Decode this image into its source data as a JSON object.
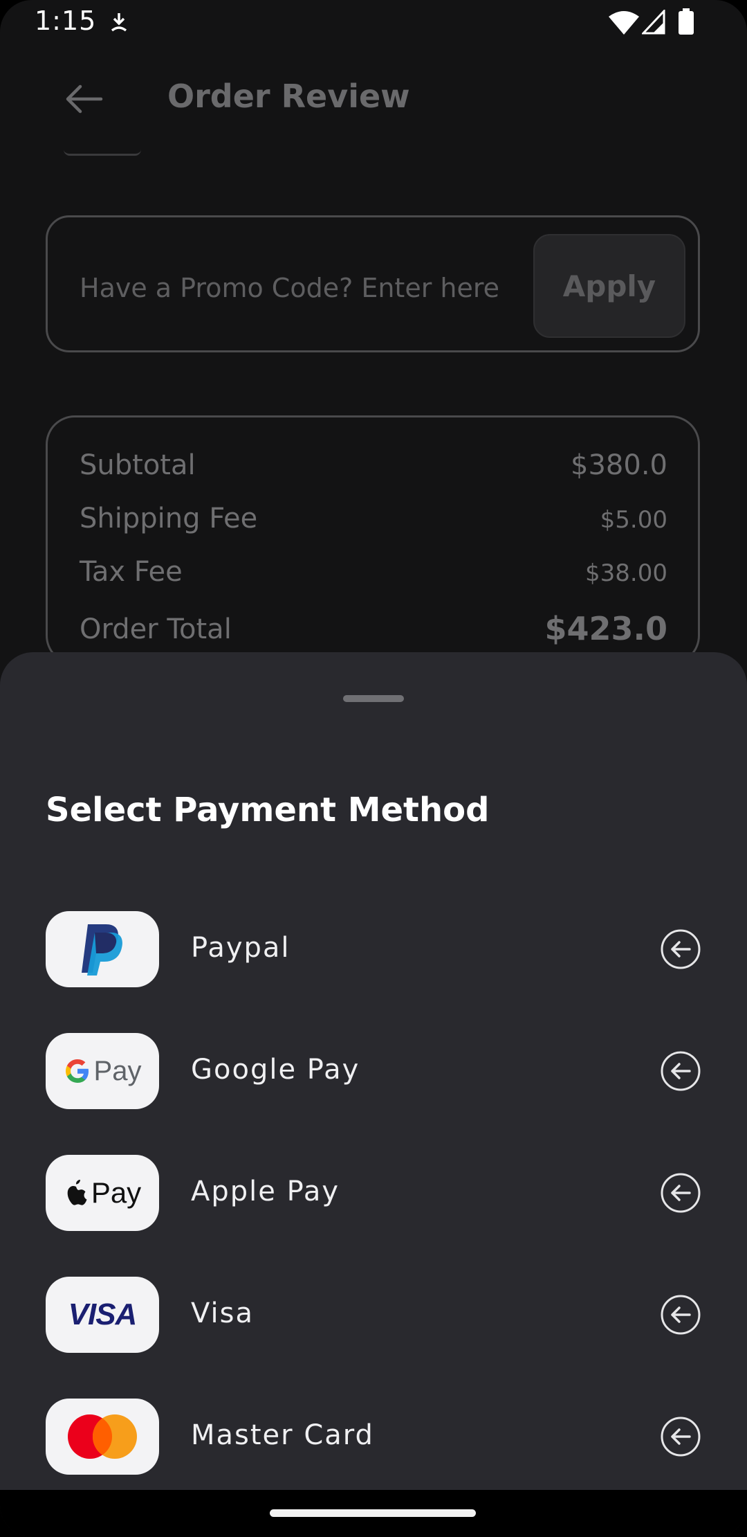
{
  "status_bar": {
    "time": "1:15",
    "icons": [
      "download-icon",
      "wifi-icon",
      "signal-icon",
      "battery-icon"
    ]
  },
  "header": {
    "title": "Order Review",
    "back_icon": "arrow-left-icon"
  },
  "promo": {
    "placeholder": "Have a Promo Code? Enter here",
    "apply_label": "Apply"
  },
  "summary": {
    "subtotal_label": "Subtotal",
    "subtotal_value": "$380.0",
    "shipping_label": "Shipping Fee",
    "shipping_value": "$5.00",
    "tax_label": "Tax Fee",
    "tax_value": "$38.00",
    "total_label": "Order Total",
    "total_value": "$423.0"
  },
  "sheet": {
    "title": "Select Payment Method",
    "methods": [
      {
        "name": "Paypal",
        "logo": "paypal-logo"
      },
      {
        "name": "Google Pay",
        "logo": "google-pay-logo",
        "logo_text": "Pay"
      },
      {
        "name": "Apple Pay",
        "logo": "apple-pay-logo",
        "logo_text": "Pay"
      },
      {
        "name": "Visa",
        "logo": "visa-logo",
        "logo_text": "VISA"
      },
      {
        "name": "Master Card",
        "logo": "mastercard-logo"
      }
    ]
  },
  "colors": {
    "sheet_bg": "#29292e",
    "page_bg": "#131314",
    "logo_bg": "#f3f3f5"
  }
}
